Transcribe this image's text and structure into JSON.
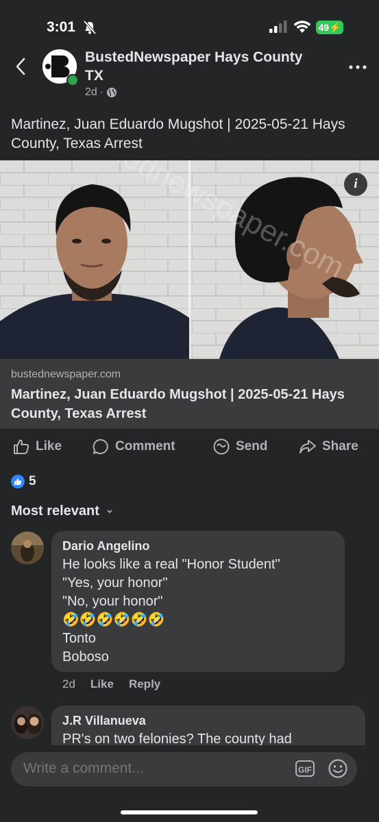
{
  "status_bar": {
    "time": "3:01",
    "battery": "49"
  },
  "post": {
    "page_name": "BustedNewspaper Hays County TX",
    "time_ago": "2d",
    "text": "Martinez, Juan Eduardo Mugshot | 2025-05-21 Hays County, Texas Arrest",
    "watermark": "bustednewspaper.com",
    "link": {
      "domain": "bustednewspaper.com",
      "title": "Martinez, Juan Eduardo Mugshot | 2025-05-21 Hays County, Texas Arrest"
    }
  },
  "actions": {
    "like": "Like",
    "comment": "Comment",
    "send": "Send",
    "share": "Share"
  },
  "reactions": {
    "count": "5"
  },
  "sort_label": "Most relevant",
  "comments": [
    {
      "author": "Dario Angelino",
      "lines": [
        "He looks like a real \"Honor Student\"",
        "\"Yes, your honor\"",
        "\"No, your honor\"",
        "🤣🤣🤣🤣🤣🤣",
        "Tonto",
        "Boboso"
      ],
      "time": "2d",
      "like_label": "Like",
      "reply_label": "Reply"
    },
    {
      "author": "J.R Villanueva",
      "lines": [
        "PR's on two felonies? The county had"
      ]
    }
  ],
  "composer": {
    "placeholder": "Write a comment...",
    "gif_label": "GIF"
  },
  "colors": {
    "background": "#242526",
    "bubble": "#3a3b3c",
    "like_blue": "#2d88ff",
    "online_green": "#31a24c",
    "battery_green": "#34c759"
  }
}
